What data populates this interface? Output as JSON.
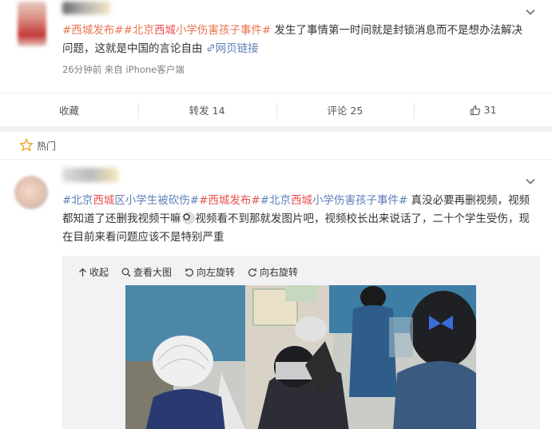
{
  "post1": {
    "text_tags": [
      "#西城发布#",
      "#北京",
      "西城",
      "小学伤害孩子事件#"
    ],
    "text_body": " 发生了事情第一时间就是封锁消息而不是想办法解决问题，这就是中国的言论自由 ",
    "web_link": "网页链接",
    "meta": "26分钟前 来自 iPhone客户端",
    "actions": {
      "collect": "收藏",
      "repost": "转发 14",
      "comment": "评论 25",
      "like": "31"
    }
  },
  "hot": {
    "label": "热门"
  },
  "post2": {
    "tag1a": "#北京",
    "tag1b": "西城",
    "tag1c": "区小学生被砍伤#",
    "tag2": "#西城发布#",
    "tag3a": "#北京",
    "tag3b": "西城",
    "tag3c": "小学伤害孩子事件#",
    "text_part1": " 真没必要再删视频，视频都知道了还删我视频干嘛",
    "text_part2": "视频看不到那就发图片吧，视频校长出来说话了，二十个学生受伤，现在目前来看问题应该不是特别严重",
    "media_toolbar": {
      "collapse": "收起",
      "view_large": "查看大图",
      "rotate_left": "向左旋转",
      "rotate_right": "向右旋转"
    }
  },
  "colors": {
    "hashtag": "#eb7350",
    "link": "#5d80b8",
    "accent_red": "#eb5050"
  }
}
